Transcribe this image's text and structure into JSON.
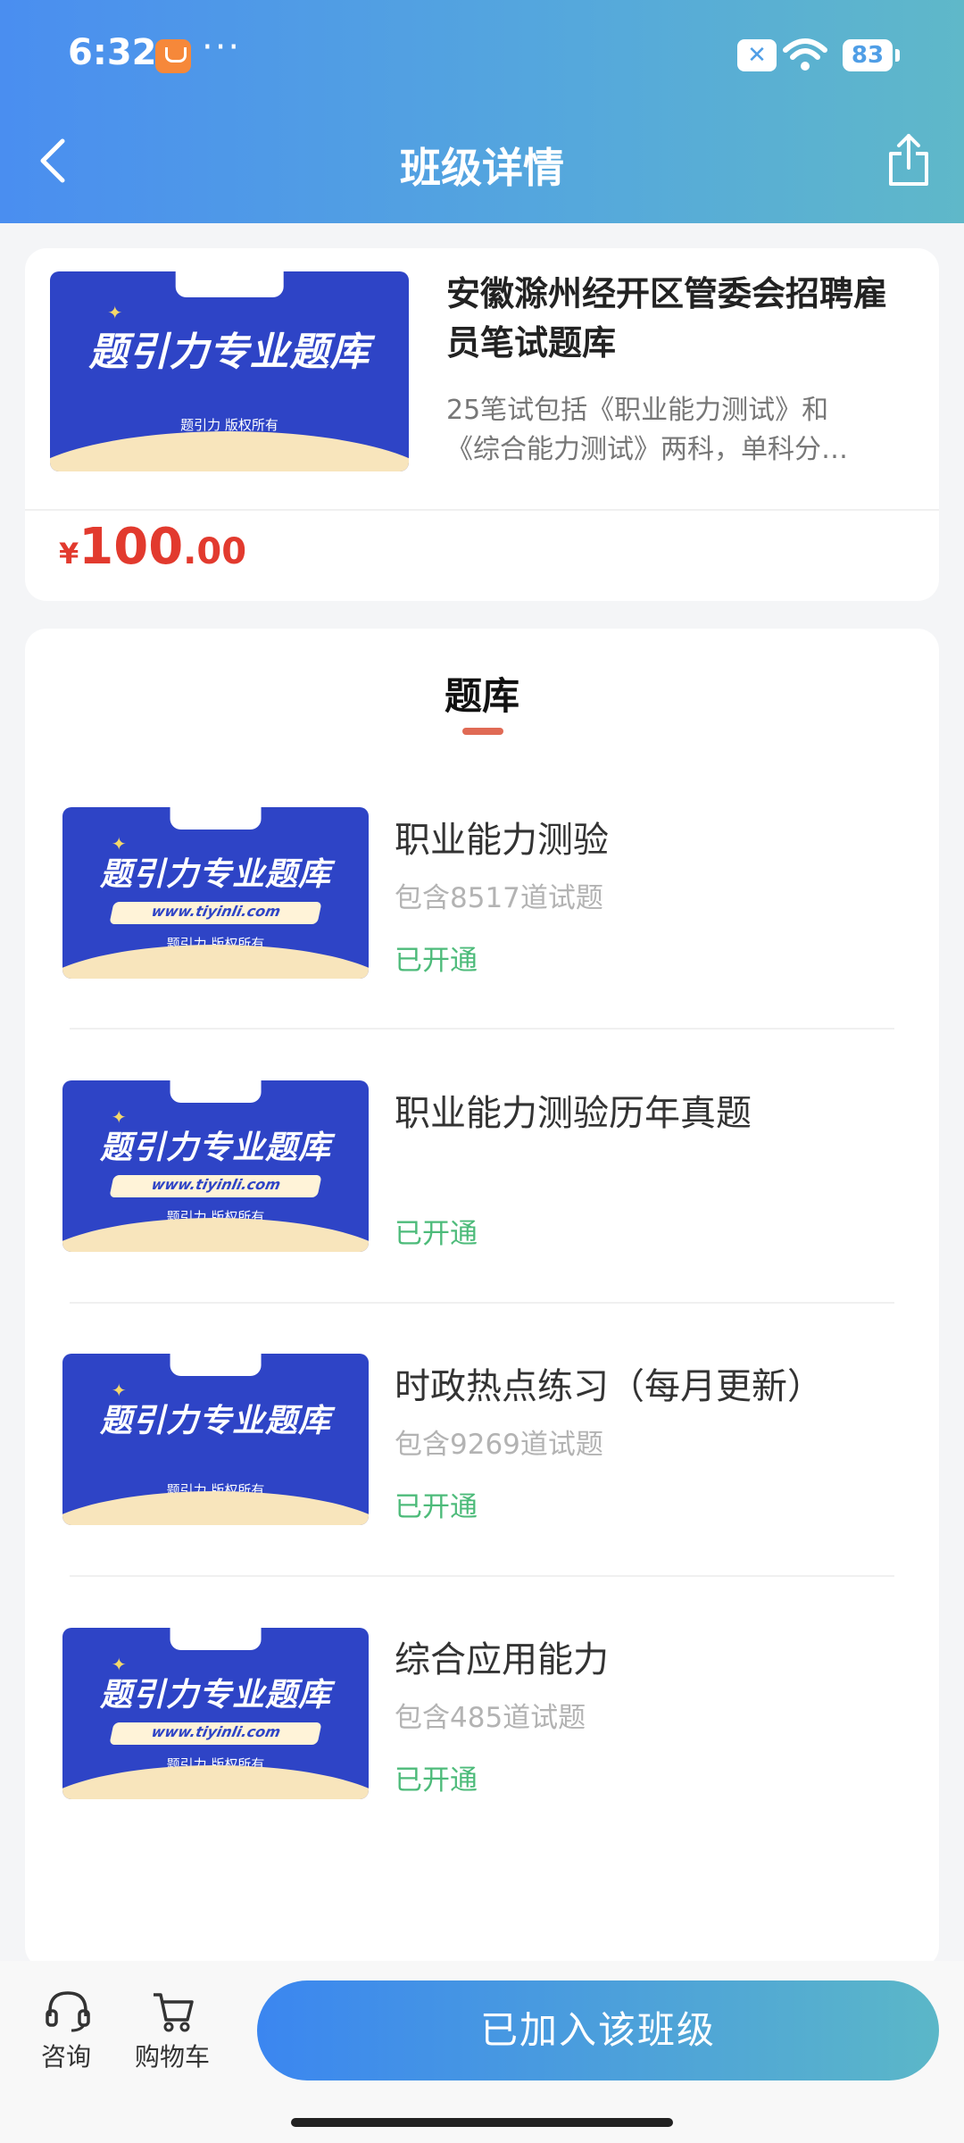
{
  "status_bar": {
    "time": "6:32",
    "dots": "···",
    "sim": "✕",
    "battery": "83"
  },
  "header": {
    "title": "班级详情"
  },
  "thumbnail": {
    "brand": "题引力",
    "title": "题引力专业题库",
    "url": "www.tiyinli.com",
    "copyright": "题引力 版权所有"
  },
  "course": {
    "title": "安徽滁州经开区管委会招聘雇员笔试题库",
    "desc_line1": "25笔试包括《职业能力测试》和",
    "desc_line2": "《综合能力测试》两科，单科分…",
    "price": {
      "currency": "¥",
      "integer": "100",
      "decimal": ".00"
    }
  },
  "section": {
    "title": "题库"
  },
  "items": [
    {
      "title": "职业能力测验",
      "count": "包含8517道试题",
      "status": "已开通"
    },
    {
      "title": "职业能力测验历年真题",
      "count": "",
      "status": "已开通"
    },
    {
      "title": "时政热点练习（每月更新）",
      "count": "包含9269道试题",
      "status": "已开通"
    },
    {
      "title": "综合应用能力",
      "count": "包含485道试题",
      "status": "已开通"
    }
  ],
  "bottom": {
    "consult": "咨询",
    "cart": "购物车",
    "join_button": "已加入该班级"
  },
  "colors": {
    "accent": "#3b86f0",
    "price": "#e23a2e",
    "status_green": "#4dbb7a",
    "tab_underline": "#e06a55"
  }
}
